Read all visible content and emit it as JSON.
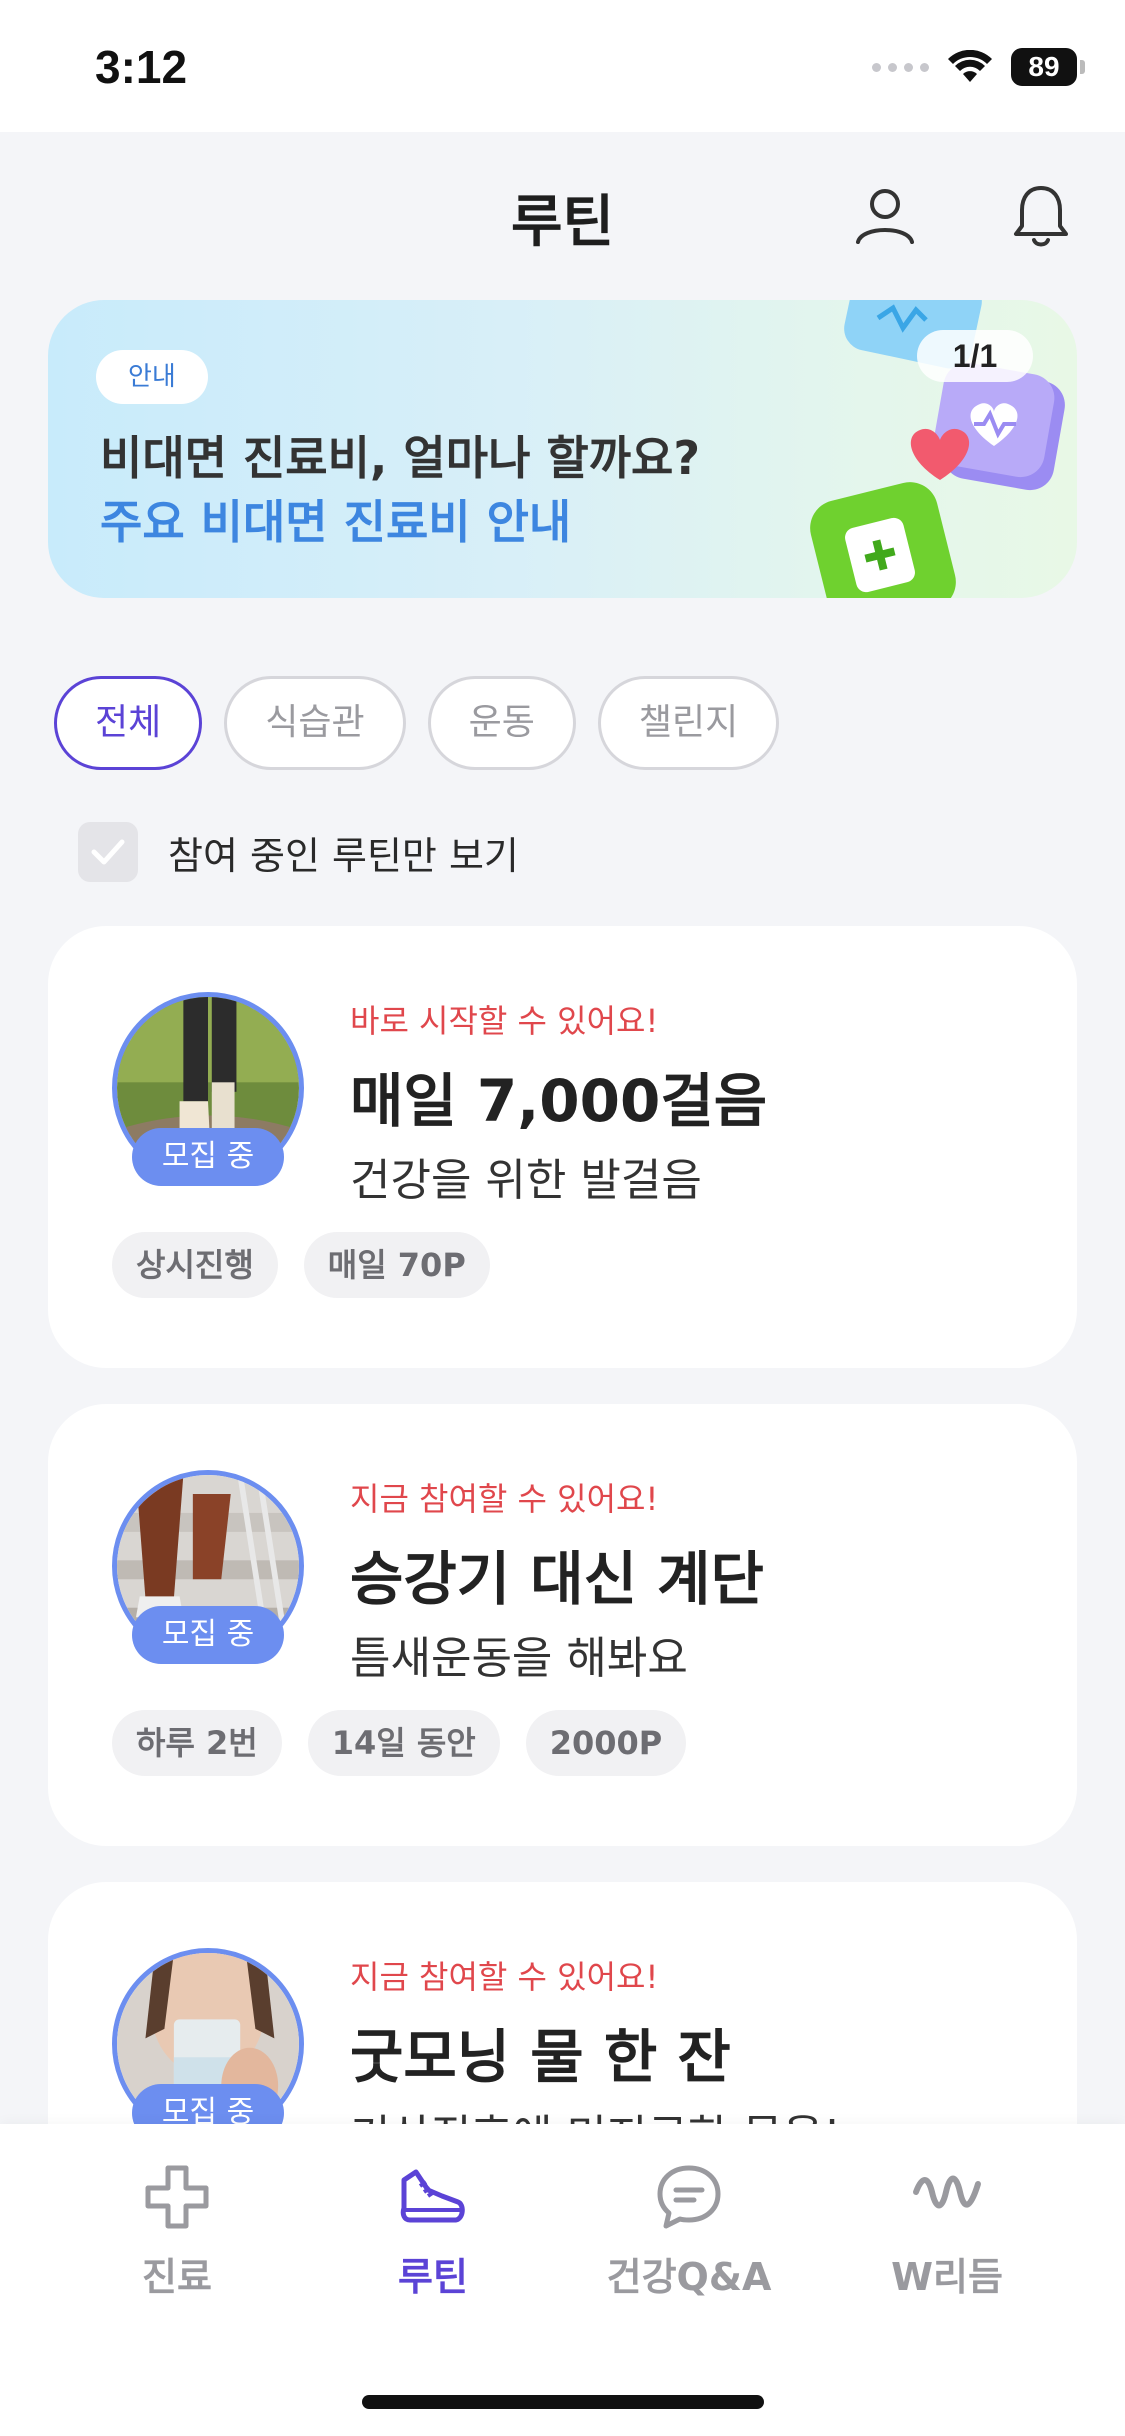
{
  "status_bar": {
    "time": "3:12",
    "battery": "89"
  },
  "header": {
    "title": "루틴"
  },
  "banner": {
    "tag": "안내",
    "title": "비대면 진료비, 얼마나 할까요?",
    "subtitle": "주요 비대면 진료비 안내",
    "counter": "1/1"
  },
  "filters": [
    {
      "label": "전체",
      "active": true
    },
    {
      "label": "식습관",
      "active": false
    },
    {
      "label": "운동",
      "active": false
    },
    {
      "label": "챌린지",
      "active": false
    }
  ],
  "participating_only": {
    "label": "참여 중인 루틴만 보기",
    "checked": false
  },
  "routines": [
    {
      "badge": "모집 중",
      "eyebrow": "바로 시작할 수 있어요!",
      "title": "매일 7,000걸음",
      "description": "건강을 위한 발걸음",
      "tags": [
        "상시진행",
        "매일 70P"
      ]
    },
    {
      "badge": "모집 중",
      "eyebrow": "지금 참여할 수 있어요!",
      "title": "승강기 대신 계단",
      "description": "틈새운동을 해봐요",
      "tags": [
        "하루 2번",
        "14일 동안",
        "2000P"
      ]
    },
    {
      "badge": "모집 중",
      "eyebrow": "지금 참여할 수 있어요!",
      "title": "굿모닝 물 한 잔",
      "description": "기상직후에 미지근한 물을!",
      "tags": []
    }
  ],
  "bottom_nav": [
    {
      "label": "진료",
      "icon": "plus-cross-icon",
      "active": false
    },
    {
      "label": "루틴",
      "icon": "sneaker-icon",
      "active": true
    },
    {
      "label": "건강Q&A",
      "icon": "chat-bubble-icon",
      "active": false
    },
    {
      "label": "W리듬",
      "icon": "wave-icon",
      "active": false
    }
  ],
  "colors": {
    "accent": "#5b43d6",
    "badge_blue": "#6c8ef0",
    "eyebrow_red": "#e0474c",
    "banner_subtitle_blue": "#3d86e0"
  }
}
